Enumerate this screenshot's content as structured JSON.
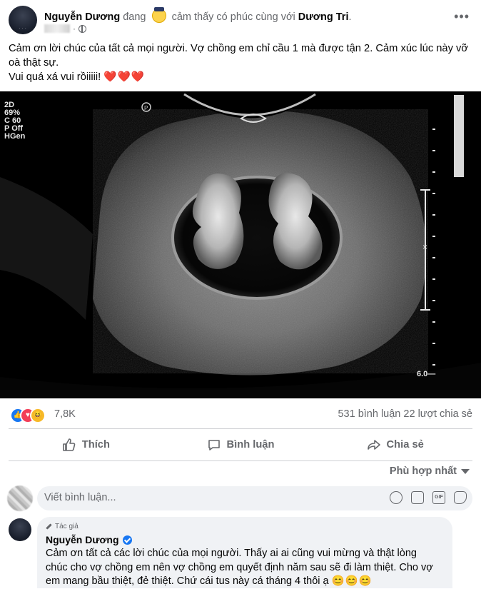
{
  "post": {
    "author": "Nguyễn Dương",
    "feeling_prefix": "đang",
    "feeling_text": "cảm thấy có phúc cùng với",
    "tagged": "Dương Tri",
    "tagged_suffix": ".",
    "lines": [
      "Cảm ơn lời chúc của tất cả mọi người. Vợ chồng em chỉ cầu 1 mà được tận 2. Cảm xúc lúc này vỡ",
      "oà thật sự.",
      "Vui quá xá vui rồiiiii!"
    ],
    "hearts": "❤️❤️❤️"
  },
  "ultrasound": {
    "overlay": [
      "2D",
      "69%",
      "C 60",
      "P Off",
      "HGen"
    ],
    "depth_label": "6.0"
  },
  "reactions": {
    "count": "7,8K",
    "comments": "531 bình luận",
    "shares": "22 lượt chia sẻ"
  },
  "actions": {
    "like": "Thích",
    "comment": "Bình luận",
    "share": "Chia sẻ"
  },
  "comments": {
    "sort_label": "Phù hợp nhất",
    "input_placeholder": "Viết bình luận...",
    "reply": {
      "tag": "Tác giả",
      "name": "Nguyễn Dương",
      "lines": [
        "Cảm ơn tất cả các lời chúc của mọi người. Thấy ai ai cũng vui mừng và thật lòng",
        "chúc cho vợ chồng em nên vợ chồng em quyết định năm sau sẽ đi làm thiệt. Cho vợ",
        "em mang bầu thiệt, đẻ thiệt. Chứ cái tus này cá tháng 4 thôi ạ"
      ],
      "emoji": "😊😊😊"
    }
  }
}
